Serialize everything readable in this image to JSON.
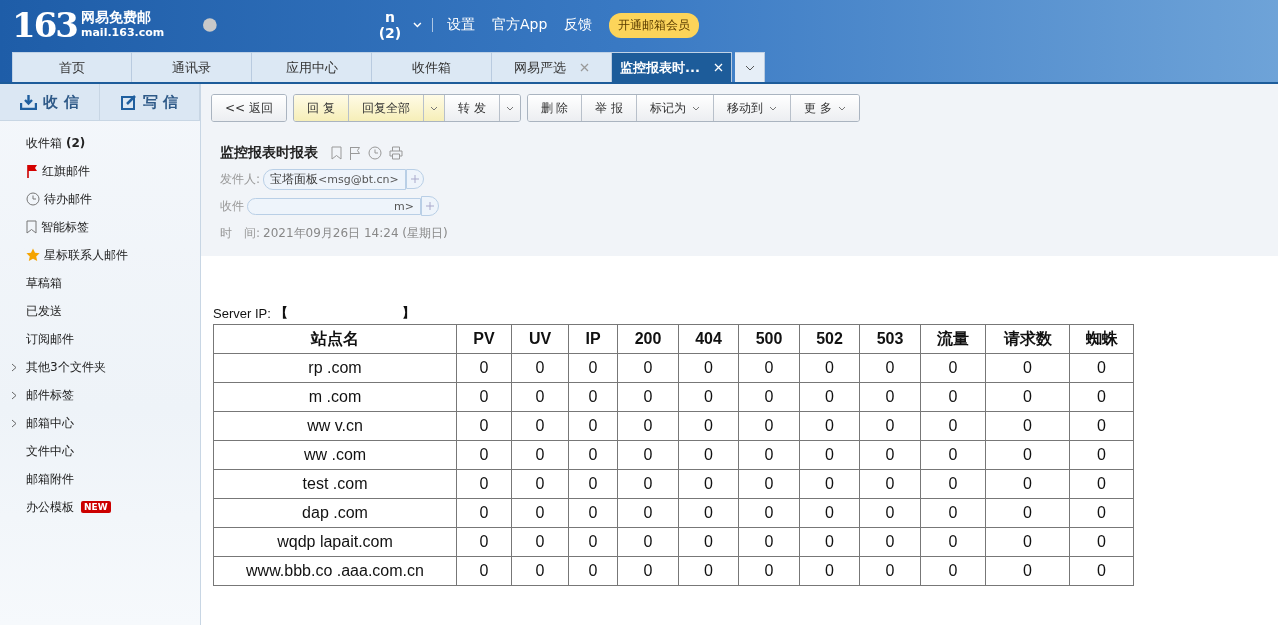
{
  "header": {
    "logo_number": "163",
    "logo_title": "网易免费邮",
    "logo_domain": "mail.163.com",
    "account": "n (2)",
    "links": [
      "设置",
      "官方App",
      "反馈"
    ],
    "vip_button": "开通邮箱会员"
  },
  "tabs": [
    {
      "label": "首页",
      "selected": false,
      "closable": false
    },
    {
      "label": "通讯录",
      "selected": false,
      "closable": false
    },
    {
      "label": "应用中心",
      "selected": false,
      "closable": false
    },
    {
      "label": "收件箱",
      "selected": false,
      "closable": false
    },
    {
      "label": "网易严选",
      "selected": false,
      "closable": true
    },
    {
      "label": "监控报表时...",
      "selected": true,
      "closable": true
    }
  ],
  "sidebar": {
    "receive": "收 信",
    "compose": "写 信",
    "items": [
      {
        "label": "收件箱",
        "count": "(2)",
        "expandable": false
      },
      {
        "label": "红旗邮件",
        "expandable": false
      },
      {
        "label": "待办邮件",
        "expandable": false
      },
      {
        "label": "智能标签",
        "expandable": false
      },
      {
        "label": "星标联系人邮件",
        "expandable": false
      },
      {
        "label": "草稿箱",
        "expandable": false
      },
      {
        "label": "已发送",
        "expandable": false
      },
      {
        "label": "订阅邮件",
        "expandable": false
      },
      {
        "label": "其他3个文件夹",
        "expandable": true
      },
      {
        "label": "邮件标签",
        "expandable": true
      },
      {
        "label": "邮箱中心",
        "expandable": true
      },
      {
        "label": "文件中心",
        "expandable": false
      },
      {
        "label": "邮箱附件",
        "expandable": false
      },
      {
        "label": "办公模板",
        "expandable": false,
        "badge": "NEW"
      }
    ]
  },
  "toolbar": {
    "groups": [
      [
        {
          "label": "<< 返回",
          "kind": "plain"
        }
      ],
      [
        {
          "label": "回 复",
          "kind": "highlight"
        },
        {
          "label": "回复全部",
          "kind": "highlight"
        },
        {
          "kind": "highlight-caret"
        },
        {
          "label": "转 发",
          "kind": "plain"
        },
        {
          "kind": "caret"
        }
      ],
      [
        {
          "label": "删 除",
          "kind": "plain"
        },
        {
          "label": "举 报",
          "kind": "plain"
        },
        {
          "label": "标记为",
          "kind": "dropdown"
        },
        {
          "label": "移动到",
          "kind": "dropdown"
        },
        {
          "label": "更 多",
          "kind": "dropdown"
        }
      ]
    ]
  },
  "message": {
    "subject": "监控报表时报表",
    "sender_label": "发件人:",
    "sender_name": "宝塔面板",
    "sender_address": "<msg@bt.cn>",
    "recipient_label": "收件",
    "recipient_value": "m>",
    "time_label": "时　间:",
    "time_value": "2021年09月26日 14:24 (星期日)"
  },
  "body": {
    "server_ip_label": "Server IP:",
    "server_ip_open": "【",
    "server_ip_close": "】",
    "table": {
      "columns": [
        "站点名",
        "PV",
        "UV",
        "IP",
        "200",
        "404",
        "500",
        "502",
        "503",
        "流量",
        "请求数",
        "蜘蛛"
      ],
      "rows": [
        [
          "rp .com",
          "0",
          "0",
          "0",
          "0",
          "0",
          "0",
          "0",
          "0",
          "0",
          "0",
          "0"
        ],
        [
          "m .com",
          "0",
          "0",
          "0",
          "0",
          "0",
          "0",
          "0",
          "0",
          "0",
          "0",
          "0"
        ],
        [
          "ww v.cn",
          "0",
          "0",
          "0",
          "0",
          "0",
          "0",
          "0",
          "0",
          "0",
          "0",
          "0"
        ],
        [
          "ww .com",
          "0",
          "0",
          "0",
          "0",
          "0",
          "0",
          "0",
          "0",
          "0",
          "0",
          "0"
        ],
        [
          "test .com",
          "0",
          "0",
          "0",
          "0",
          "0",
          "0",
          "0",
          "0",
          "0",
          "0",
          "0"
        ],
        [
          "dap .com",
          "0",
          "0",
          "0",
          "0",
          "0",
          "0",
          "0",
          "0",
          "0",
          "0",
          "0"
        ],
        [
          "wqdp lapait.com",
          "0",
          "0",
          "0",
          "0",
          "0",
          "0",
          "0",
          "0",
          "0",
          "0",
          "0"
        ],
        [
          "www.bbb.co .aaa.com.cn",
          "0",
          "0",
          "0",
          "0",
          "0",
          "0",
          "0",
          "0",
          "0",
          "0",
          "0"
        ]
      ]
    }
  }
}
